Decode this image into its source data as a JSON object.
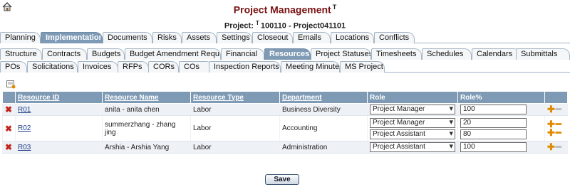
{
  "app_title": "Project Management",
  "title_marker": "T",
  "project": {
    "label": "Project:",
    "marker": "T",
    "value": "100110 - Project041101"
  },
  "tabs_row1": [
    "Planning",
    "Implementation",
    "Documents",
    "Risks",
    "Assets",
    "Settings",
    "Closeout",
    "Emails",
    "Locations",
    "Conflicts"
  ],
  "tabs_row2": [
    "Structure",
    "Contracts",
    "Budgets",
    "Budget Amendment Requests",
    "Financial",
    "Resources",
    "Project Statuses",
    "Timesheets",
    "Schedules",
    "Calendars",
    "Submittals"
  ],
  "tabs_row3": [
    "POs",
    "Solicitations",
    "Invoices",
    "RFPs",
    "CORs",
    "COs",
    "Inspection Reports",
    "Meeting Minutes",
    "MS Project"
  ],
  "active": {
    "row1": "Implementation",
    "row2": "Resources"
  },
  "table": {
    "headers": [
      "Resource ID",
      "Resource Name",
      "Resource Type",
      "Department",
      "Role",
      "Role%"
    ],
    "rows": [
      {
        "id": "R01",
        "name": "anita - anita chen",
        "type": "Labor",
        "dept": "Business Diversity",
        "roles": [
          {
            "role": "Project Manager",
            "pct": "100"
          }
        ]
      },
      {
        "id": "R02",
        "name": "summerzhang - zhang jing",
        "type": "Labor",
        "dept": "Accounting",
        "roles": [
          {
            "role": "Project Manager",
            "pct": "20"
          },
          {
            "role": "Project Assistant",
            "pct": "80"
          }
        ]
      },
      {
        "id": "R03",
        "name": "Arshia - Arshia Yang",
        "type": "Labor",
        "dept": "Administration",
        "roles": [
          {
            "role": "Project Assistant",
            "pct": "100"
          }
        ]
      }
    ]
  },
  "save_label": "Save",
  "icons": {
    "home": "home-icon",
    "add_row": "add-row-icon",
    "delete": "delete-icon",
    "add": "plus-icon",
    "remove": "minus-icon"
  },
  "colors": {
    "title": "#7a1212",
    "header_bg": "#7f9ab4",
    "active_tab": "#7f9ab4",
    "link": "#1e3f8a"
  }
}
